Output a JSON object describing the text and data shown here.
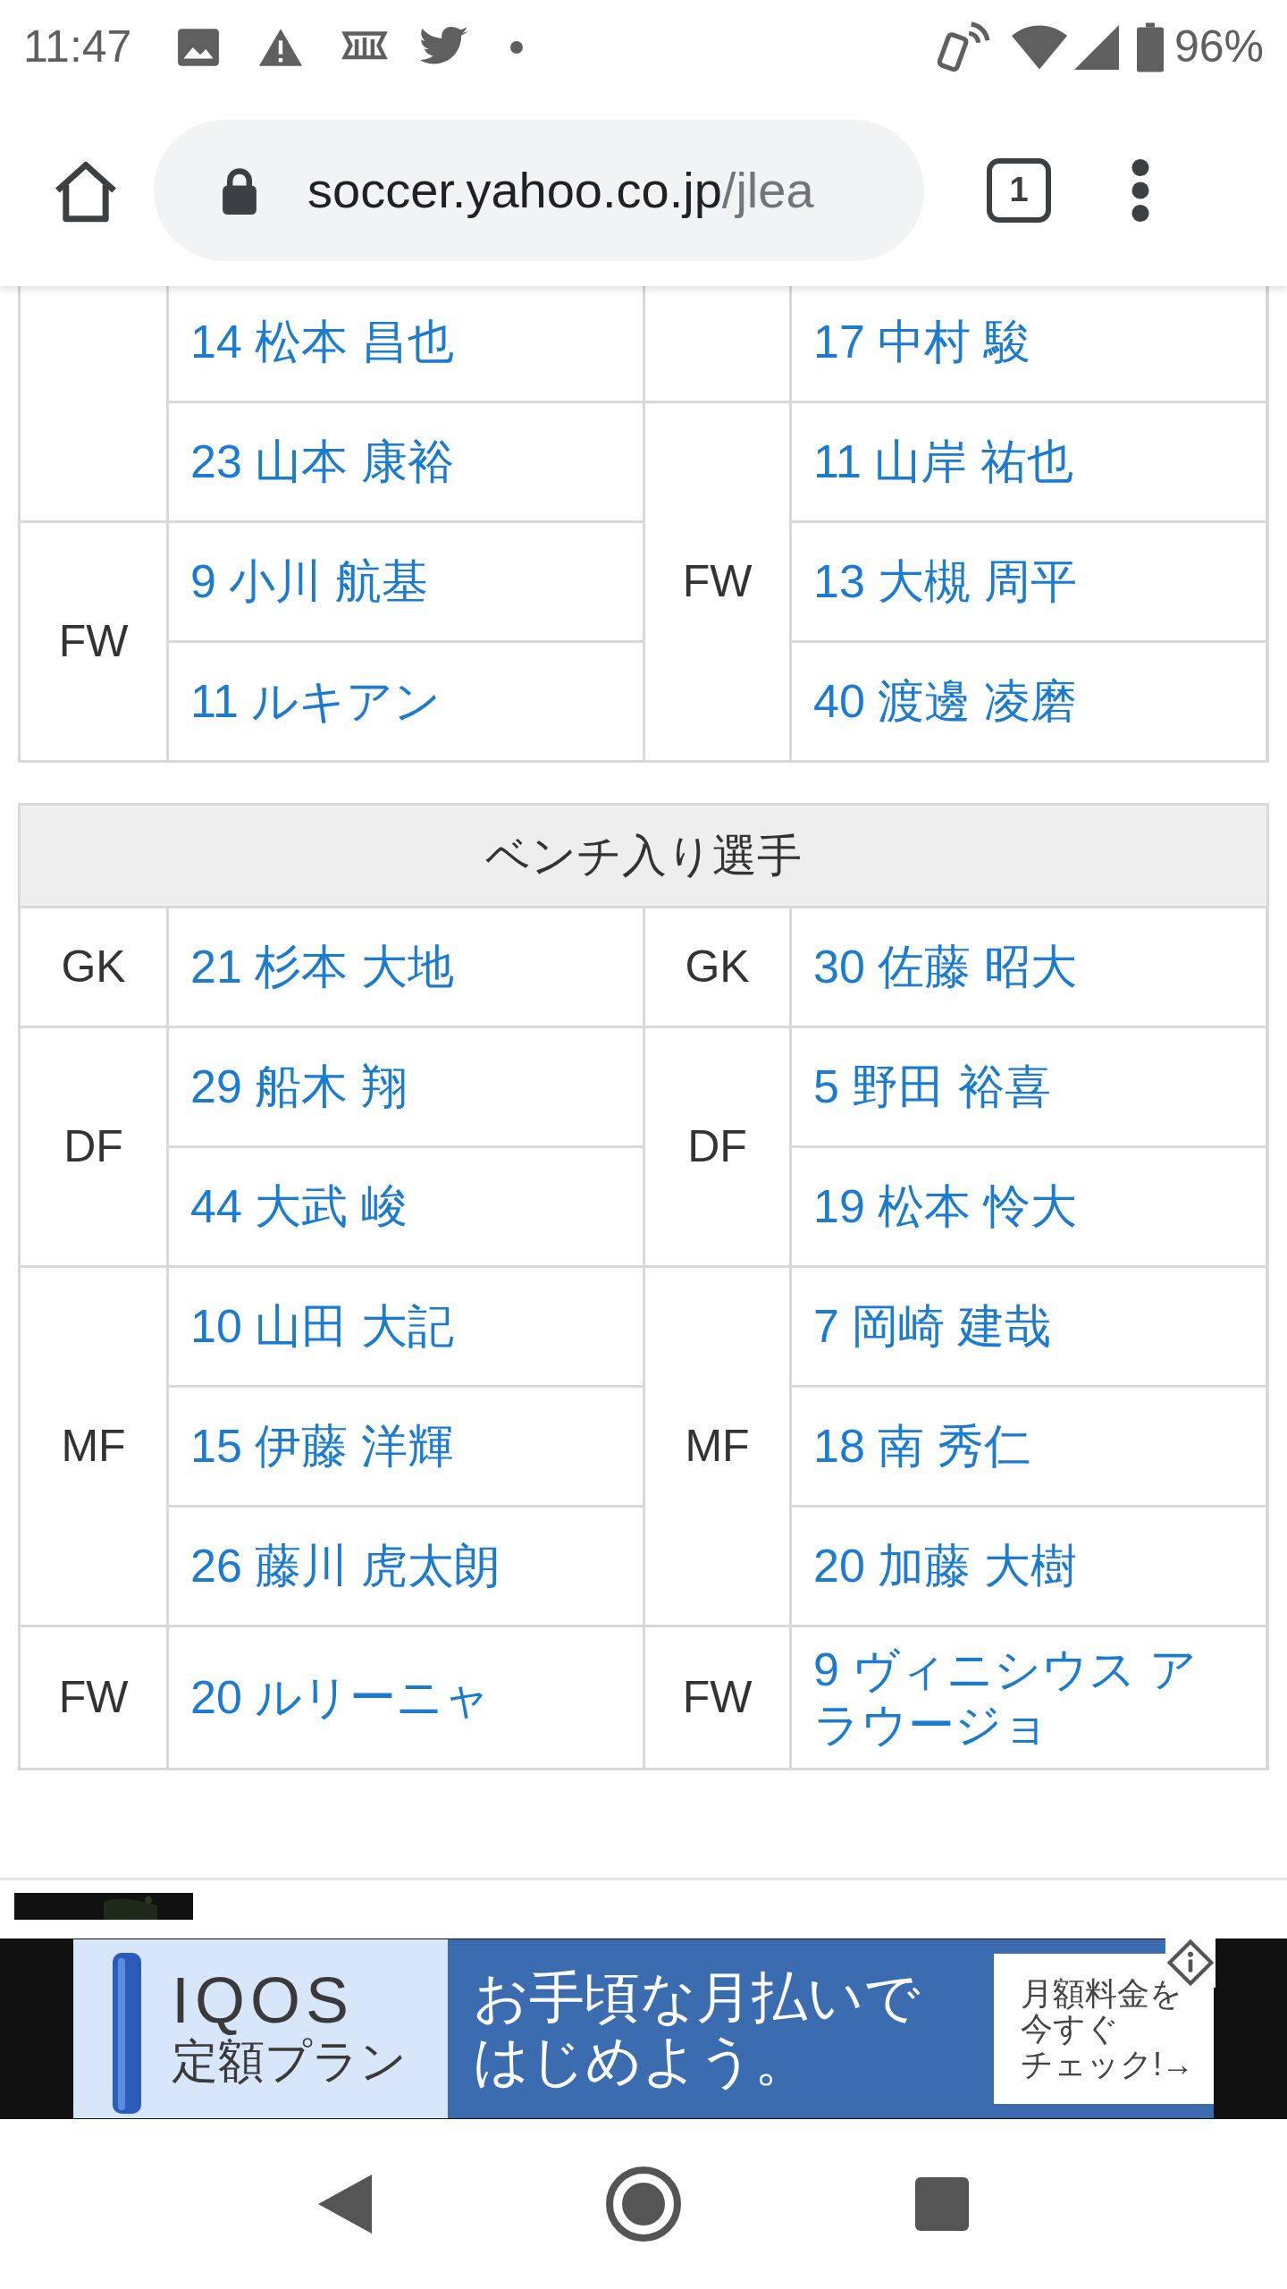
{
  "status_bar": {
    "time": "11:47",
    "battery": "96%"
  },
  "browser": {
    "url_host": "soccer.yahoo.co.jp",
    "url_path": "/jlea",
    "tab_count": "1"
  },
  "starters": {
    "left": [
      {
        "players": [
          "14 松本 昌也",
          "23 山本 康裕"
        ]
      },
      {
        "position": "FW",
        "players": [
          "9 小川 航基",
          "11 ルキアン"
        ]
      }
    ],
    "right": [
      {
        "players": [
          "17 中村 駿"
        ]
      },
      {
        "position": "FW",
        "players": [
          "11 山岸 祐也",
          "13 大槻 周平",
          "40 渡邊 凌磨"
        ]
      }
    ]
  },
  "bench": {
    "title": "ベンチ入り選手",
    "left": [
      {
        "position": "GK",
        "players": [
          "21 杉本 大地"
        ]
      },
      {
        "position": "DF",
        "players": [
          "29 船木 翔",
          "44 大武 峻"
        ]
      },
      {
        "position": "MF",
        "players": [
          "10 山田 大記",
          "15 伊藤 洋輝",
          "26 藤川 虎太朗"
        ]
      },
      {
        "position": "FW",
        "players": [
          "20 ルリーニャ"
        ]
      }
    ],
    "right": [
      {
        "position": "GK",
        "players": [
          "30 佐藤 昭大"
        ]
      },
      {
        "position": "DF",
        "players": [
          "5 野田 裕喜",
          "19 松本 怜大"
        ]
      },
      {
        "position": "MF",
        "players": [
          "7 岡崎 建哉",
          "18 南 秀仁",
          "20 加藤 大樹"
        ]
      },
      {
        "position": "FW",
        "players": [
          "9 ヴィニシウス アラウージョ"
        ]
      }
    ]
  },
  "ad": {
    "brand": "IQOS",
    "plan": "定額プラン",
    "headline": [
      "お手頃な月払いで",
      "はじめよう。"
    ],
    "cta": [
      "月額料金を",
      "今すぐ",
      "チェック!→"
    ]
  }
}
